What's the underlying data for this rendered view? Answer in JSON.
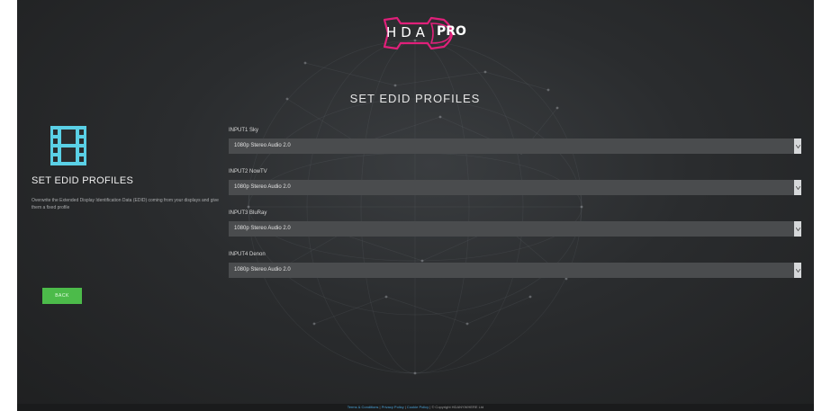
{
  "logo": {
    "text": "HDA",
    "badge": "PRO"
  },
  "page_title": "SET EDID PROFILES",
  "sidebar": {
    "icon": "film-strip-icon",
    "title": "SET EDID PROFILES",
    "description": "Overwrite the Extended Display Identification Data (EDID) coming from your displays and give them a fixed profile",
    "back_label": "BACK"
  },
  "inputs": [
    {
      "label": "INPUT1 Sky",
      "value": "1080p Stereo Audio 2.0"
    },
    {
      "label": "INPUT2 NowTV",
      "value": "1080p Stereo Audio 2.0"
    },
    {
      "label": "INPUT3 BluRay",
      "value": "1080p Stereo Audio 2.0"
    },
    {
      "label": "INPUT4 Denon",
      "value": "1080p Stereo Audio 2.0"
    }
  ],
  "footer": {
    "terms": "Terms & Conditions",
    "sep1": " | ",
    "privacy": "Privacy Policy",
    "sep2": " | ",
    "cookie": "Cookie Policy",
    "copyright": " | © Copyright HDANYWHERE Ltd"
  },
  "colors": {
    "accent_green": "#4cbb4a",
    "logo_pink": "#e0207a",
    "icon_cyan": "#5ad0e6",
    "link_blue": "#4aa3d8"
  }
}
